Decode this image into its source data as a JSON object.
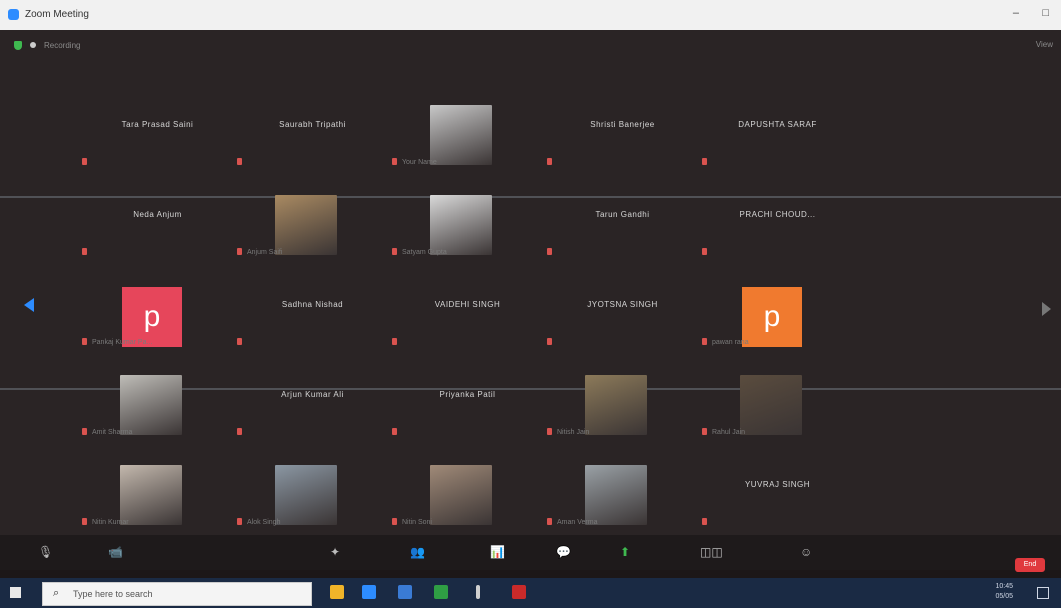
{
  "window": {
    "title": "Zoom Meeting",
    "minimize": "–",
    "maximize": "□"
  },
  "topbar": {
    "recording_text": "Recording",
    "view_label": "View"
  },
  "rows": [
    [
      {
        "type": "name",
        "name": "Tara Prasad Saini",
        "label": ""
      },
      {
        "type": "name",
        "name": "Saurabh Tripathi",
        "label": ""
      },
      {
        "type": "photo",
        "name": "",
        "label": "Your Name",
        "color": "#c8c8c8"
      },
      {
        "type": "name",
        "name": "Shristi Banerjee",
        "label": ""
      },
      {
        "type": "name",
        "name": "DAPUSHTA SARAF",
        "label": ""
      }
    ],
    [
      {
        "type": "name",
        "name": "Neda Anjum",
        "label": ""
      },
      {
        "type": "photo",
        "name": "",
        "label": "Anjum Saifi",
        "color": "#a98a62"
      },
      {
        "type": "photo",
        "name": "",
        "label": "Satyam Gupta",
        "color": "#d9d9d9"
      },
      {
        "type": "name",
        "name": "Tarun Gandhi",
        "label": ""
      },
      {
        "type": "name",
        "name": "PRACHI CHOUD...",
        "label": ""
      }
    ],
    [
      {
        "type": "avatar",
        "name": "",
        "letter": "p",
        "label": "Pankaj Kumar Pa...",
        "color": "#e6465b"
      },
      {
        "type": "name",
        "name": "Sadhna Nishad",
        "label": ""
      },
      {
        "type": "name",
        "name": "VAIDEHI SINGH",
        "label": ""
      },
      {
        "type": "name",
        "name": "JYOTSNA SINGH",
        "label": ""
      },
      {
        "type": "avatar",
        "name": "",
        "letter": "p",
        "label": "pawan rana",
        "color": "#f07a2f"
      }
    ],
    [
      {
        "type": "photo",
        "name": "",
        "label": "Amit Sharma",
        "color": "#bfbdb8"
      },
      {
        "type": "name",
        "name": "Arjun Kumar Ali",
        "label": ""
      },
      {
        "type": "name",
        "name": "Priyanka Patil",
        "label": ""
      },
      {
        "type": "photo",
        "name": "",
        "label": "Nitish Jain",
        "color": "#8c7a5a"
      },
      {
        "type": "photo",
        "name": "",
        "label": "Rahul Jain",
        "color": "#5a4c3e"
      }
    ],
    [
      {
        "type": "photo",
        "name": "",
        "label": "Nitin Kumar",
        "color": "#c3b8ad"
      },
      {
        "type": "photo",
        "name": "",
        "label": "Alok Singh",
        "color": "#8b97a3"
      },
      {
        "type": "photo",
        "name": "",
        "label": "Nitin Soni",
        "color": "#a08a78"
      },
      {
        "type": "photo",
        "name": "",
        "label": "Aman Verma",
        "color": "#9aa1a6"
      },
      {
        "type": "name",
        "name": "YUVRAJ SINGH",
        "label": ""
      }
    ]
  ],
  "toolbar": {
    "mute": "🎙",
    "video": "📹",
    "security": "✦",
    "participants": "👥",
    "polls": "📊",
    "chat": "💬",
    "share": "⬆",
    "breakout": "◫◫",
    "reactions": "☺",
    "end_label": "End"
  },
  "taskbar": {
    "search_placeholder": "Type here to search",
    "clock_time": "10:45",
    "clock_date": "05/05"
  }
}
